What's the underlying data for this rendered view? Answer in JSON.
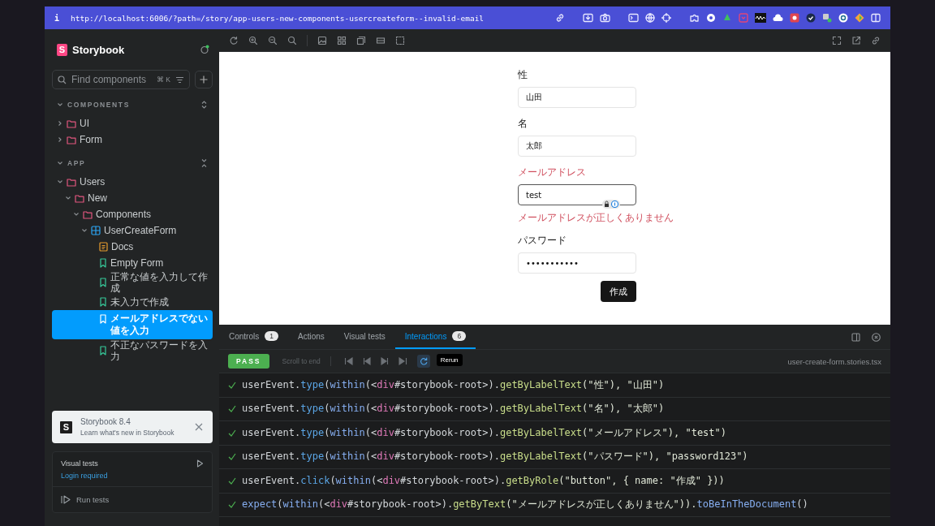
{
  "browser": {
    "info": "i",
    "url": "http://localhost:6006/?path=/story/app-users-new-components-usercreateform--invalid-email"
  },
  "sidebar": {
    "logo_mark": "S",
    "brand": "Storybook",
    "search": {
      "placeholder": "Find components",
      "shortcut": "⌘ K"
    },
    "sections": [
      {
        "title": "COMPONENTS",
        "items": [
          {
            "kind": "folder",
            "label": "UI",
            "expanded": false,
            "selected": false
          },
          {
            "kind": "folder",
            "label": "Form",
            "expanded": false,
            "selected": false
          }
        ]
      },
      {
        "title": "APP",
        "items": [
          {
            "kind": "folder",
            "label": "Users",
            "expanded": true,
            "selected": false,
            "children": [
              {
                "kind": "folder",
                "label": "New",
                "expanded": true,
                "selected": false,
                "children": [
                  {
                    "kind": "folder",
                    "label": "Components",
                    "expanded": true,
                    "selected": false,
                    "children": [
                      {
                        "kind": "component",
                        "label": "UserCreateForm",
                        "expanded": true,
                        "selected": false,
                        "children": [
                          {
                            "kind": "docs",
                            "label": "Docs",
                            "selected": false
                          },
                          {
                            "kind": "story",
                            "label": "Empty Form",
                            "selected": false
                          },
                          {
                            "kind": "story",
                            "label": "正常な値を入力して作成",
                            "selected": false
                          },
                          {
                            "kind": "story",
                            "label": "未入力で作成",
                            "selected": false
                          },
                          {
                            "kind": "story",
                            "label": "メールアドレスでない値を入力",
                            "selected": true
                          },
                          {
                            "kind": "story",
                            "label": "不正なパスワードを入力",
                            "selected": false
                          }
                        ]
                      }
                    ]
                  }
                ]
              }
            ]
          }
        ]
      }
    ],
    "notification": {
      "icon": "S",
      "title": "Storybook 8.4",
      "text": "Learn what's new in Storybook"
    },
    "visual_tests": {
      "title": "Visual tests",
      "status": "Login required",
      "action": "Run tests"
    }
  },
  "form": {
    "fields": [
      {
        "label": "性",
        "value": "山田",
        "invalid": false
      },
      {
        "label": "名",
        "value": "太郎",
        "invalid": false
      },
      {
        "label": "メールアドレス",
        "value": "test",
        "invalid": true,
        "error": "メールアドレスが正しくありません"
      },
      {
        "label": "パスワード",
        "value": "•••••••••••",
        "invalid": false
      }
    ],
    "submit": "作成"
  },
  "panel": {
    "tabs": [
      {
        "label": "Controls",
        "count": "1",
        "selected": false
      },
      {
        "label": "Actions",
        "selected": false
      },
      {
        "label": "Visual tests",
        "selected": false
      },
      {
        "label": "Interactions",
        "count": "6",
        "selected": true
      }
    ],
    "status": "PASS",
    "scroll_to_end": "Scroll to end",
    "tooltip": "Rerun",
    "file": "user-create-form.stories.tsx",
    "steps": [
      {
        "passed": true,
        "tokens": [
          {
            "text": "userEvent.",
            "kind": "plain"
          },
          {
            "text": "type",
            "kind": "method"
          },
          {
            "text": "(",
            "kind": "plain"
          },
          {
            "text": "within",
            "kind": "fn"
          },
          {
            "text": "(<",
            "kind": "plain"
          },
          {
            "text": "div",
            "kind": "tag"
          },
          {
            "text": "#storybook-root>).",
            "kind": "plain"
          },
          {
            "text": "getByLabelText",
            "kind": "query"
          },
          {
            "text": "(\"性\"), \"山田\")",
            "kind": "string"
          }
        ]
      },
      {
        "passed": true,
        "tokens": [
          {
            "text": "userEvent.",
            "kind": "plain"
          },
          {
            "text": "type",
            "kind": "method"
          },
          {
            "text": "(",
            "kind": "plain"
          },
          {
            "text": "within",
            "kind": "fn"
          },
          {
            "text": "(<",
            "kind": "plain"
          },
          {
            "text": "div",
            "kind": "tag"
          },
          {
            "text": "#storybook-root>).",
            "kind": "plain"
          },
          {
            "text": "getByLabelText",
            "kind": "query"
          },
          {
            "text": "(\"名\"), \"太郎\")",
            "kind": "string"
          }
        ]
      },
      {
        "passed": true,
        "tokens": [
          {
            "text": "userEvent.",
            "kind": "plain"
          },
          {
            "text": "type",
            "kind": "method"
          },
          {
            "text": "(",
            "kind": "plain"
          },
          {
            "text": "within",
            "kind": "fn"
          },
          {
            "text": "(<",
            "kind": "plain"
          },
          {
            "text": "div",
            "kind": "tag"
          },
          {
            "text": "#storybook-root>).",
            "kind": "plain"
          },
          {
            "text": "getByLabelText",
            "kind": "query"
          },
          {
            "text": "(\"メールアドレス\"), \"test\")",
            "kind": "string"
          }
        ]
      },
      {
        "passed": true,
        "tokens": [
          {
            "text": "userEvent.",
            "kind": "plain"
          },
          {
            "text": "type",
            "kind": "method"
          },
          {
            "text": "(",
            "kind": "plain"
          },
          {
            "text": "within",
            "kind": "fn"
          },
          {
            "text": "(<",
            "kind": "plain"
          },
          {
            "text": "div",
            "kind": "tag"
          },
          {
            "text": "#storybook-root>).",
            "kind": "plain"
          },
          {
            "text": "getByLabelText",
            "kind": "query"
          },
          {
            "text": "(\"パスワード\"), \"password123\")",
            "kind": "string"
          }
        ]
      },
      {
        "passed": true,
        "tokens": [
          {
            "text": "userEvent.",
            "kind": "plain"
          },
          {
            "text": "click",
            "kind": "method"
          },
          {
            "text": "(",
            "kind": "plain"
          },
          {
            "text": "within",
            "kind": "fn"
          },
          {
            "text": "(<",
            "kind": "plain"
          },
          {
            "text": "div",
            "kind": "tag"
          },
          {
            "text": "#storybook-root>).",
            "kind": "plain"
          },
          {
            "text": "getByRole",
            "kind": "query"
          },
          {
            "text": "(\"button\", { name: \"作成\" }))",
            "kind": "string"
          }
        ]
      },
      {
        "passed": true,
        "tokens": [
          {
            "text": "expect",
            "kind": "fn"
          },
          {
            "text": "(",
            "kind": "plain"
          },
          {
            "text": "within",
            "kind": "fn"
          },
          {
            "text": "(<",
            "kind": "plain"
          },
          {
            "text": "div",
            "kind": "tag"
          },
          {
            "text": "#storybook-root>).",
            "kind": "plain"
          },
          {
            "text": "getByText",
            "kind": "query"
          },
          {
            "text": "(\"メールアドレスが正しくありません\")).",
            "kind": "string"
          },
          {
            "text": "toBeInTheDocument",
            "kind": "fn"
          },
          {
            "text": "()",
            "kind": "plain"
          }
        ]
      }
    ]
  }
}
